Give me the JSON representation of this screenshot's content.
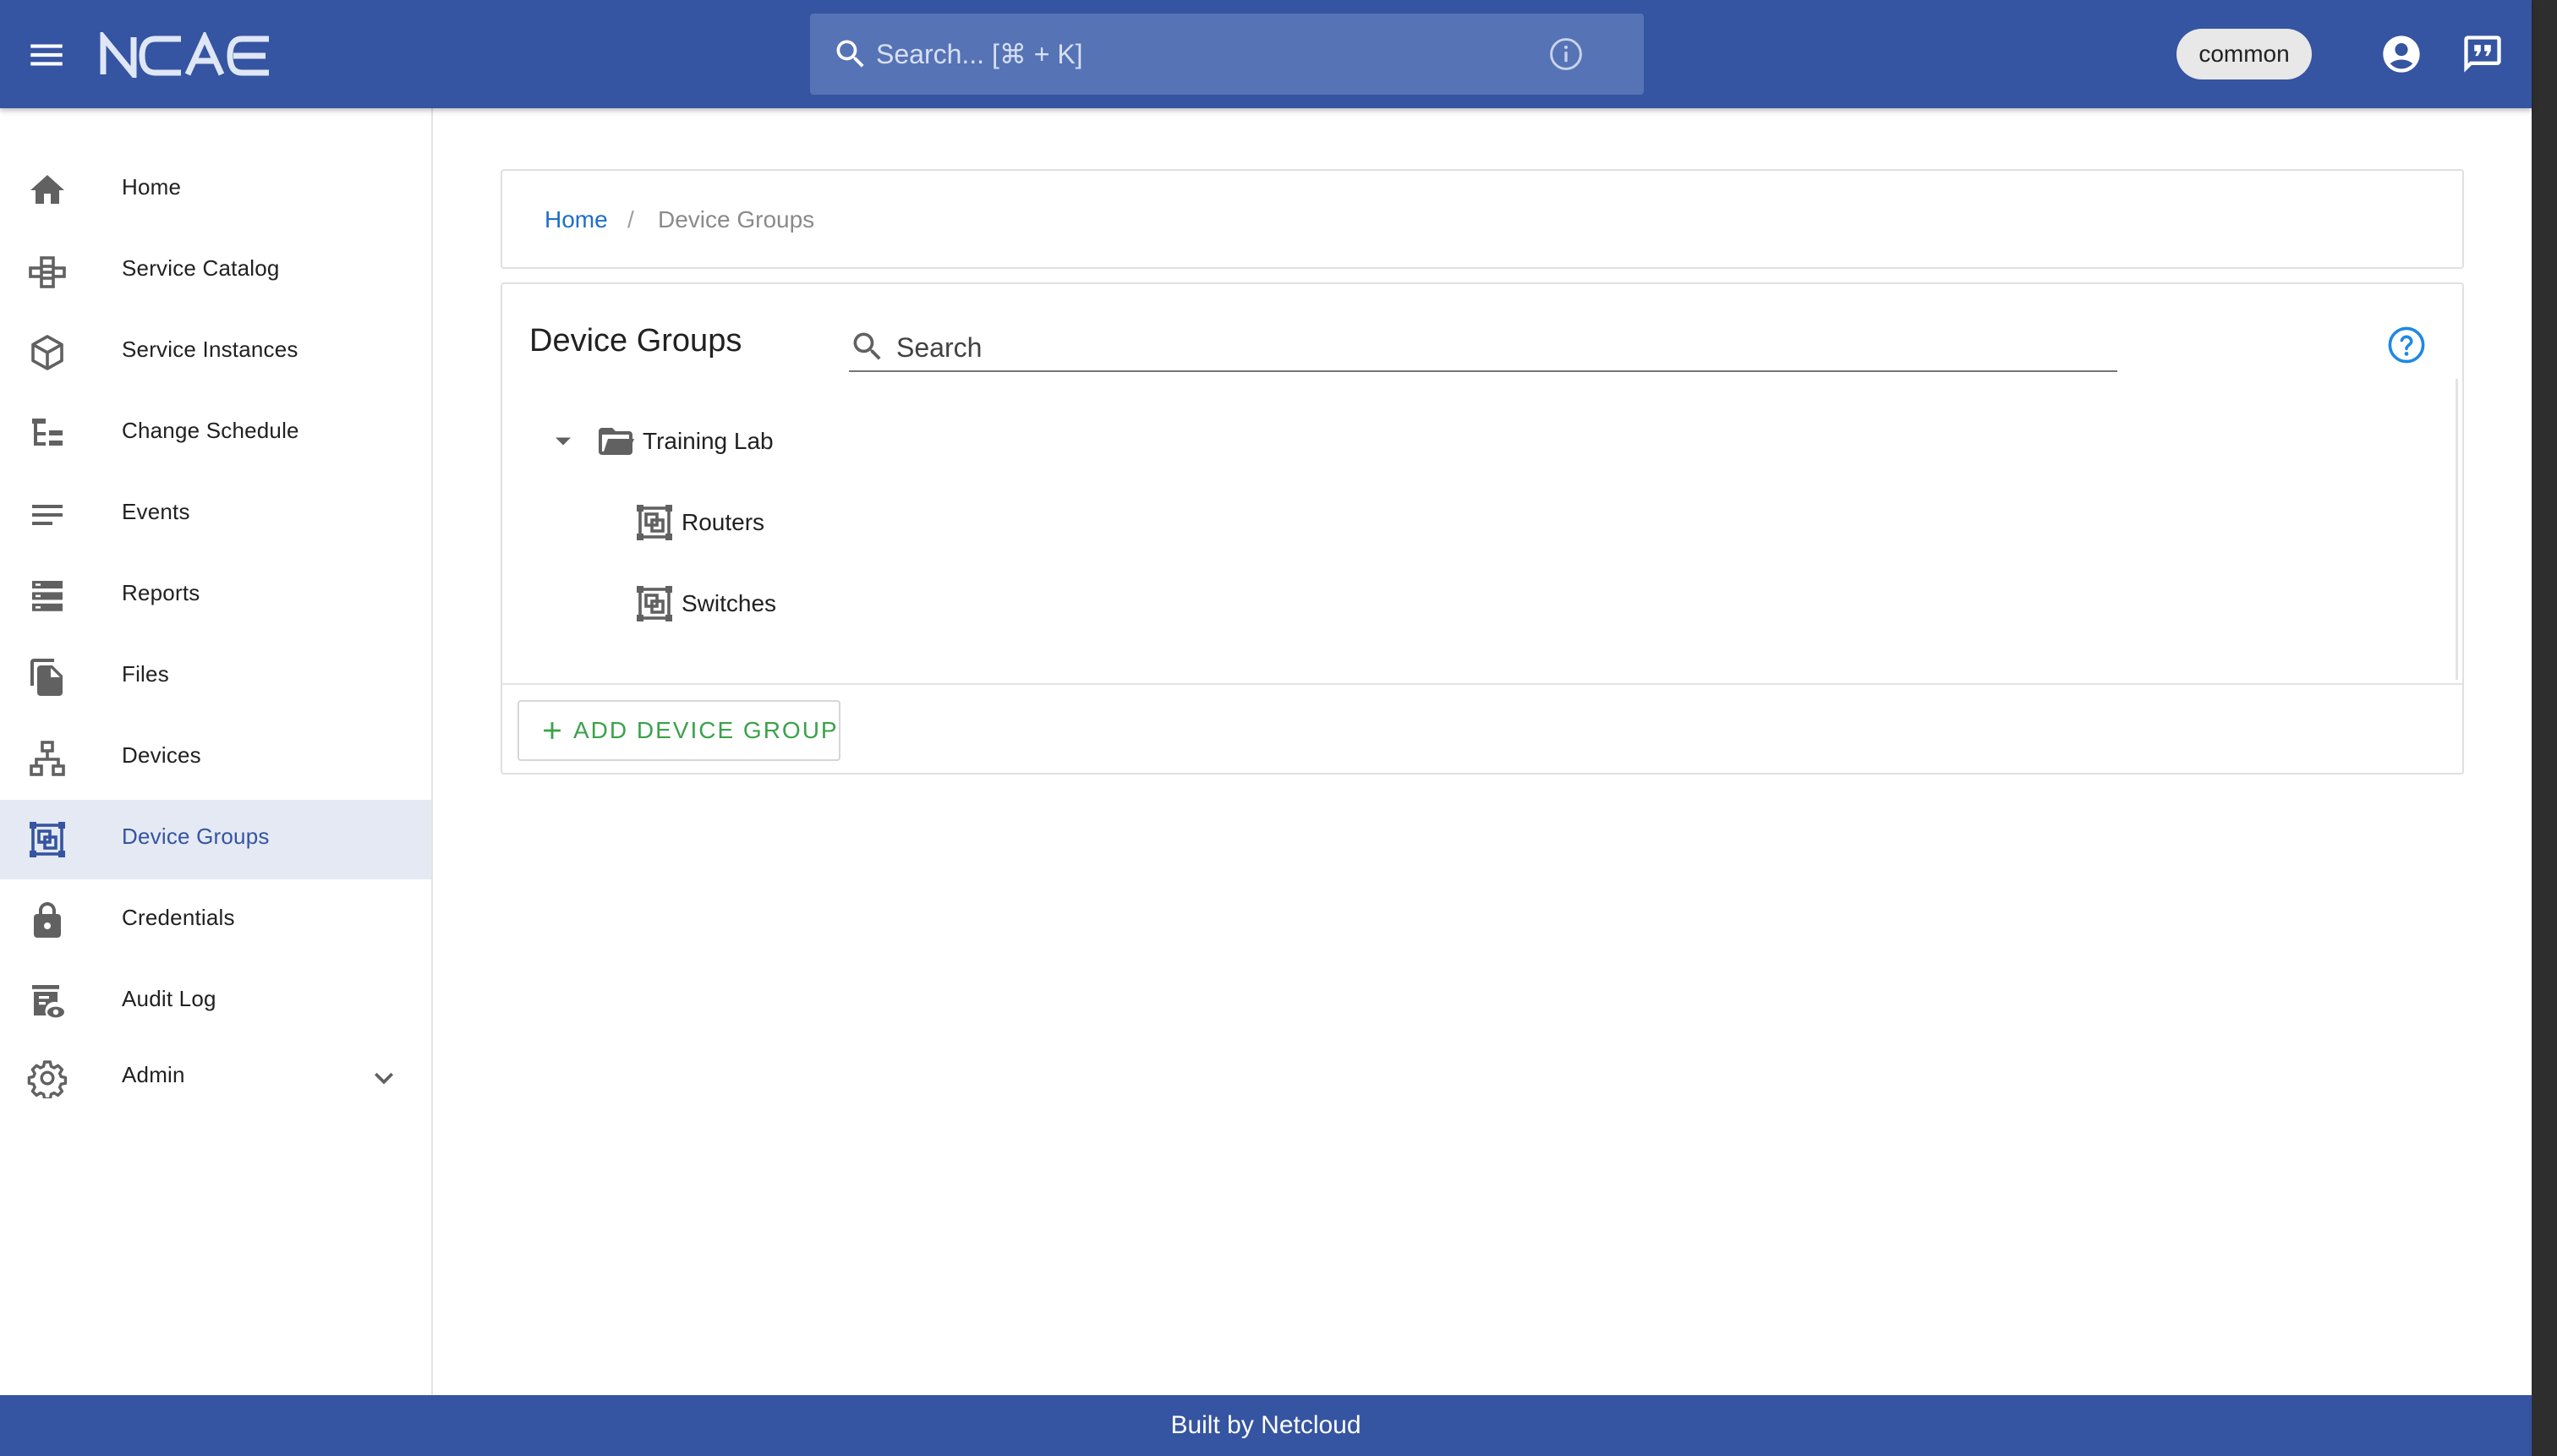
{
  "header": {
    "logo_text": "NCAE",
    "search_placeholder": "Search... [⌘ + K]",
    "tenant": "common"
  },
  "sidebar": {
    "items": [
      {
        "label": "Home",
        "icon": "home-icon"
      },
      {
        "label": "Service Catalog",
        "icon": "catalog-icon"
      },
      {
        "label": "Service Instances",
        "icon": "cube-icon"
      },
      {
        "label": "Change Schedule",
        "icon": "schedule-tree-icon"
      },
      {
        "label": "Events",
        "icon": "lines-icon"
      },
      {
        "label": "Reports",
        "icon": "reports-icon"
      },
      {
        "label": "Files",
        "icon": "files-icon"
      },
      {
        "label": "Devices",
        "icon": "network-icon"
      },
      {
        "label": "Device Groups",
        "icon": "device-groups-icon",
        "active": true
      },
      {
        "label": "Credentials",
        "icon": "lock-icon"
      },
      {
        "label": "Audit Log",
        "icon": "audit-icon"
      },
      {
        "label": "Admin",
        "icon": "gear-icon"
      }
    ]
  },
  "breadcrumb": {
    "home": "Home",
    "separator": "/",
    "current": "Device Groups"
  },
  "device_groups": {
    "title": "Device Groups",
    "search_placeholder": "Search",
    "tree": {
      "root": "Training Lab",
      "children": [
        "Routers",
        "Switches"
      ]
    },
    "add_button": "ADD DEVICE GROUP"
  },
  "footer": {
    "text": "Built by Netcloud"
  },
  "colors": {
    "brand": "#3554a1",
    "link": "#1e6ec8",
    "add_green": "#3aa24a",
    "active_bg": "#e4e9f3"
  }
}
